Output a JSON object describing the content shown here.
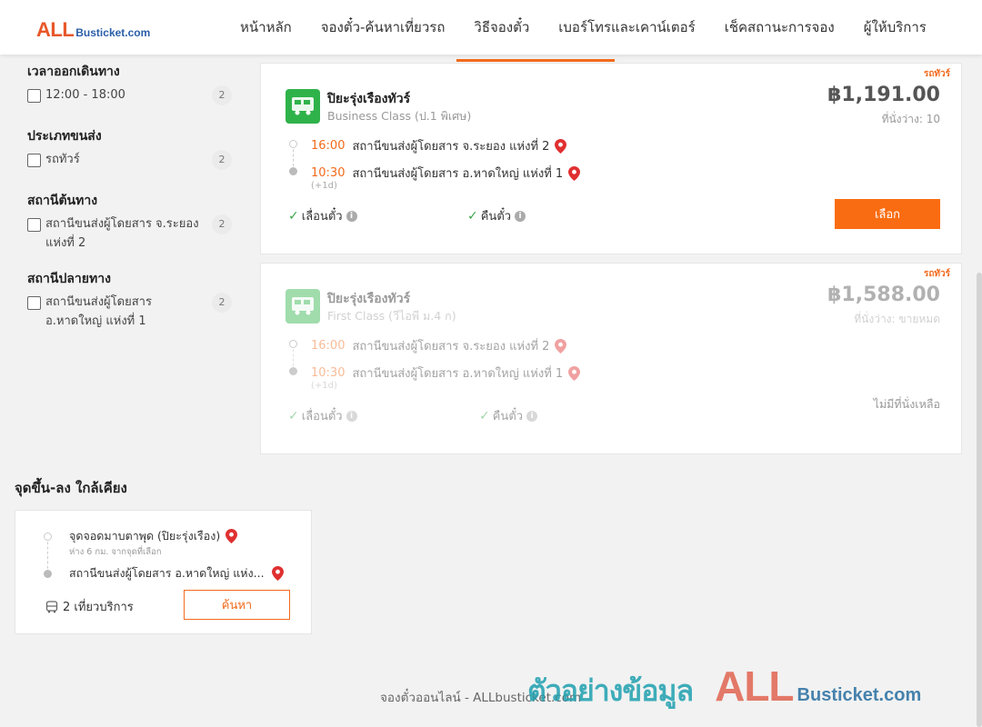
{
  "header": {
    "logo_all": "ALL",
    "logo_rest": "Busticket.com",
    "nav": [
      {
        "label": "หน้าหลัก"
      },
      {
        "label": "จองตั๋ว-ค้นหาเที่ยวรถ"
      },
      {
        "label": "วิธีจองตั๋ว"
      },
      {
        "label": "เบอร์โทรและเคาน์เตอร์"
      },
      {
        "label": "เช็คสถานะการจอง"
      },
      {
        "label": "ผู้ให้บริการ"
      }
    ],
    "active_index": 2
  },
  "filters": [
    {
      "title": "เวลาออกเดินทาง",
      "options": [
        {
          "label": "12:00 - 18:00",
          "count": "2",
          "checked": false
        }
      ]
    },
    {
      "title": "ประเภทขนส่ง",
      "options": [
        {
          "label": "รถทัวร์",
          "count": "2",
          "checked": false
        }
      ]
    },
    {
      "title": "สถานีต้นทาง",
      "options": [
        {
          "label": "สถานีขนส่งผู้โดยสาร จ.ระยอง แห่งที่ 2",
          "count": "2",
          "checked": false
        }
      ]
    },
    {
      "title": "สถานีปลายทาง",
      "options": [
        {
          "label": "สถานีขนส่งผู้โดยสาร อ.หาดใหญ่ แห่งที่ 1",
          "count": "2",
          "checked": false
        }
      ]
    }
  ],
  "results": [
    {
      "tag": "รถทัวร์",
      "operator": "ปิยะรุ่งเรืองทัวร์",
      "bus_class": "Business Class (ป.1 พิเศษ)",
      "price": "฿1,191.00",
      "seats": "ที่นั่งว่าง: 10",
      "depart_time": "16:00",
      "depart_station": "สถานีขนส่งผู้โดยสาร จ.ระยอง แห่งที่ 2",
      "arrive_time": "10:30",
      "arrive_station": "สถานีขนส่งผู้โดยสาร อ.หาดใหญ่ แห่งที่ 1",
      "day_offset": "(+1d)",
      "feature_1": "เลื่อนตั๋ว",
      "feature_2": "คืนตั๋ว",
      "action": "เลือก",
      "available": true
    },
    {
      "tag": "รถทัวร์",
      "operator": "ปิยะรุ่งเรืองทัวร์",
      "bus_class": "First Class (วีไอพี ม.4 ก)",
      "price": "฿1,588.00",
      "seats": "ที่นั่งว่าง: ขายหมด",
      "depart_time": "16:00",
      "depart_station": "สถานีขนส่งผู้โดยสาร จ.ระยอง แห่งที่ 2",
      "arrive_time": "10:30",
      "arrive_station": "สถานีขนส่งผู้โดยสาร อ.หาดใหญ่ แห่งที่ 1",
      "day_offset": "(+1d)",
      "feature_1": "เลื่อนตั๋ว",
      "feature_2": "คืนตั๋ว",
      "action": "ไม่มีที่นั่งเหลือ",
      "available": false
    }
  ],
  "nearby": {
    "title": "จุดขึ้น-ลง ใกล้เคียง",
    "stop_1": "จุดจอดมาบตาพุด (ปิยะรุ่งเรือง)",
    "distance": "ห่าง 6 กม. จากจุดที่เลือก",
    "stop_2": "สถานีขนส่งผู้โดยสาร อ.หาดใหญ่ แห่ง...",
    "trips": "2 เที่ยวบริการ",
    "search_label": "ค้นหา"
  },
  "footer": {
    "text": "จองตั๋วออนไลน์ - ALLbusticket.com"
  },
  "watermark": {
    "text": "ตัวอย่างข้อมูล",
    "logo_all": "ALL",
    "logo_rest": "Busticket.com"
  },
  "colors": {
    "accent": "#fa6c11",
    "check": "#3aa548",
    "pin": "#e03030",
    "logo_green": "#2fb24a"
  }
}
